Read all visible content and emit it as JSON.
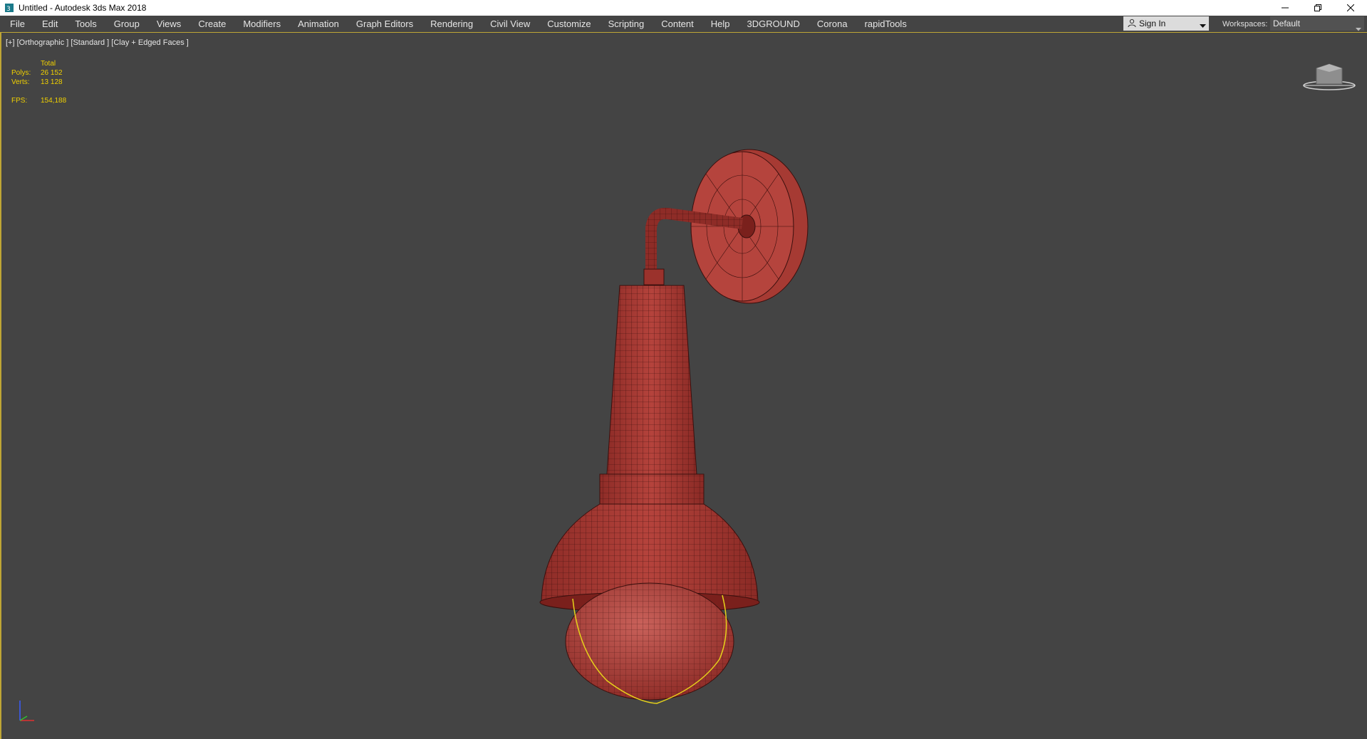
{
  "window": {
    "title": "Untitled - Autodesk 3ds Max 2018",
    "controls": [
      "minimize-icon",
      "restore-icon",
      "close-icon"
    ]
  },
  "menu": [
    "File",
    "Edit",
    "Tools",
    "Group",
    "Views",
    "Create",
    "Modifiers",
    "Animation",
    "Graph Editors",
    "Rendering",
    "Civil View",
    "Customize",
    "Scripting",
    "Content",
    "Help",
    "3DGROUND",
    "Corona",
    "rapidTools"
  ],
  "account": {
    "sign_in_label": "Sign In"
  },
  "workspaces": {
    "label": "Workspaces:",
    "value": "Default"
  },
  "viewport": {
    "label": "[+] [Orthographic ] [Standard ] [Clay + Edged Faces ]",
    "stats": {
      "header": "Total",
      "polys_label": "Polys:",
      "polys_value": "26 152",
      "verts_label": "Verts:",
      "verts_value": "13 128",
      "fps_label": "FPS:",
      "fps_value": "154,188"
    }
  },
  "colors": {
    "viewport_bg": "#444444",
    "mesh": "#b03a34",
    "wire": "#3a0f0d",
    "selection": "#e6d21a",
    "stats_text": "#f0d000",
    "active_border": "#bfa635"
  }
}
